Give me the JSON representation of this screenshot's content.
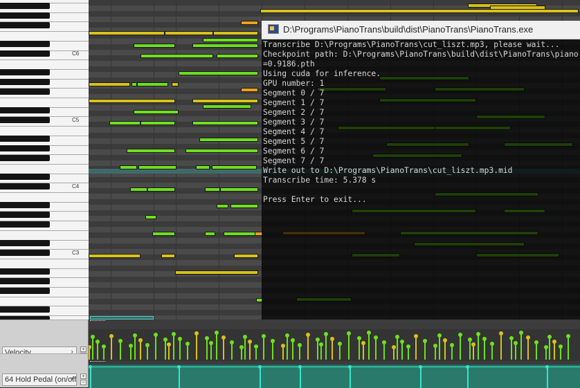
{
  "keyboard": {
    "octave_labels": [
      "C6",
      "C5",
      "C4",
      "C3"
    ]
  },
  "console_window": {
    "title": "D:\\Programs\\PianoTrans\\build\\dist\\PianoTrans\\PianoTrans.exe",
    "lines": [
      "Transcribe D:\\Programs\\PianoTrans\\cut_liszt.mp3, please wait...",
      "Checkpoint path: D:\\Programs\\PianoTrans\\build\\dist\\PianoTrans\\piano",
      "=0.9186.pth",
      "Using cuda for inference.",
      "GPU number: 1",
      "Segment 0 / 7",
      "Segment 1 / 7",
      "Segment 2 / 7",
      "Segment 3 / 7",
      "Segment 4 / 7",
      "Segment 5 / 7",
      "Segment 6 / 7",
      "Segment 7 / 7",
      "Write out to D:\\Programs\\PianoTrans\\cut_liszt.mp3.mid",
      "Transcribe time: 5.378 s",
      "",
      "Press Enter to exit..."
    ]
  },
  "lanes": {
    "velocity": {
      "label": "Velocity"
    },
    "pedal": {
      "label": "64 Hold Pedal (on/off)"
    }
  },
  "colors": {
    "note_green": "#6ee01e",
    "note_yellow": "#d8c21a",
    "note_orange": "#f0a01a",
    "pedal": "#36e6c8"
  }
}
